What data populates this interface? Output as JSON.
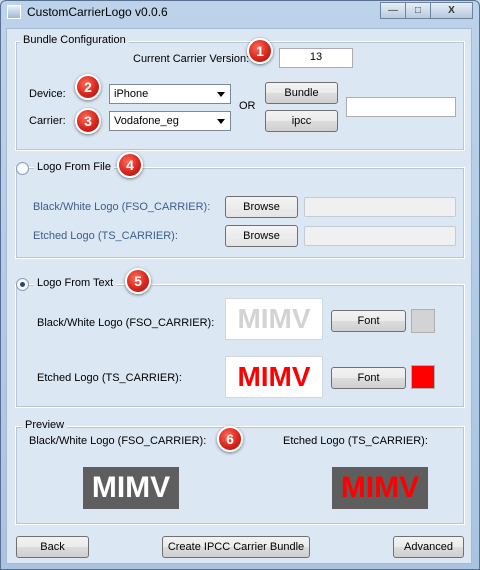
{
  "window": {
    "title": "CustomCarrierLogo v0.0.6",
    "minimize_glyph": "—",
    "maximize_glyph": "□",
    "close_glyph": "X"
  },
  "bundle_config": {
    "legend": "Bundle Configuration",
    "version_label": "Current Carrier Version:",
    "version_value": "13",
    "device_label": "Device:",
    "device_value": "iPhone",
    "carrier_label": "Carrier:",
    "carrier_value": "Vodafone_eg",
    "or_label": "OR",
    "bundle_button": "Bundle",
    "ipcc_button": "ipcc",
    "path_value": ""
  },
  "logo_from_file": {
    "legend": "Logo From File",
    "selected": false,
    "bw_label": "Black/White Logo  (FSO_CARRIER):",
    "etched_label": "Etched Logo (TS_CARRIER):",
    "browse_label": "Browse",
    "bw_path": "",
    "etched_path": ""
  },
  "logo_from_text": {
    "legend": "Logo From Text",
    "selected": true,
    "bw_label": "Black/White Logo  (FSO_CARRIER):",
    "etched_label": "Etched Logo (TS_CARRIER):",
    "bw_text": "MIMV",
    "etched_text": "MIMV",
    "font_label": "Font",
    "bw_color": "#d3d3d3",
    "etched_color": "#ff0000"
  },
  "preview": {
    "legend": "Preview",
    "bw_label": "Black/White Logo  (FSO_CARRIER):",
    "etched_label": "Etched Logo (TS_CARRIER):",
    "bw_text": "MIMV",
    "etched_text": "MIMV",
    "bg_color": "#5e5e5e"
  },
  "footer": {
    "back_button": "Back",
    "create_button": "Create IPCC Carrier Bundle",
    "advanced_button": "Advanced"
  },
  "badges": [
    "1",
    "2",
    "3",
    "4",
    "5",
    "6"
  ]
}
